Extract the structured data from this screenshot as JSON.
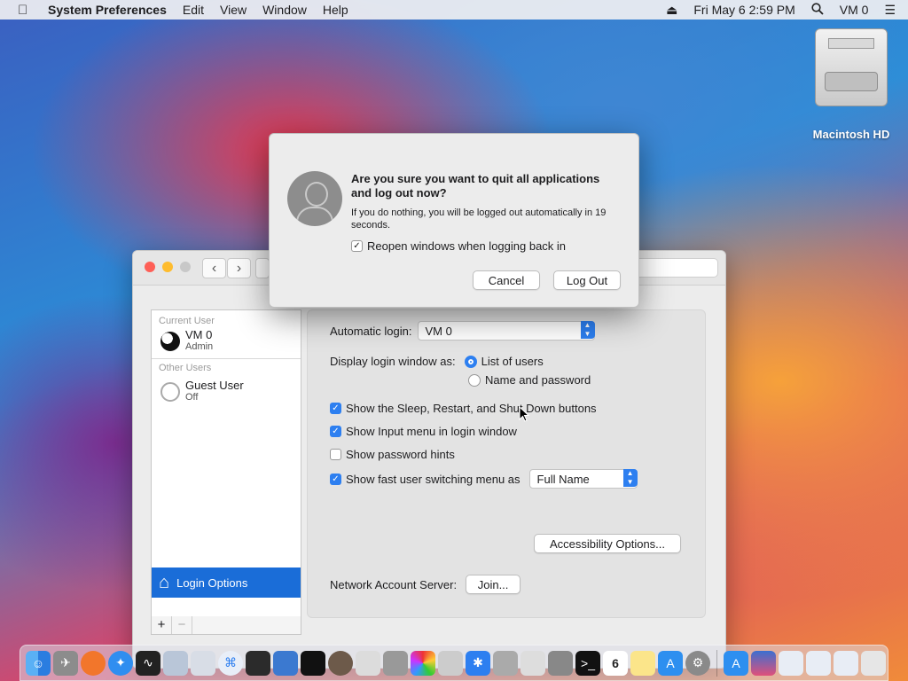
{
  "menubar": {
    "app": "System Preferences",
    "items": [
      "Edit",
      "View",
      "Window",
      "Help"
    ],
    "datetime": "Fri May 6  2:59 PM",
    "user": "VM 0"
  },
  "desktop": {
    "drive_label": "Macintosh HD"
  },
  "dialog": {
    "title": "Are you sure you want to quit all applications and log out now?",
    "info": "If you do nothing, you will be logged out automatically in 19 seconds.",
    "reopen_label": "Reopen windows when logging back in",
    "reopen_checked": true,
    "cancel": "Cancel",
    "logout": "Log Out"
  },
  "sidebar": {
    "current_user_header": "Current User",
    "current_user": {
      "name": "VM 0",
      "role": "Admin"
    },
    "other_users_header": "Other Users",
    "other_user": {
      "name": "Guest User",
      "role": "Off"
    },
    "login_options": "Login Options",
    "add": "+",
    "remove": "−"
  },
  "panel": {
    "automatic_login_label": "Automatic login:",
    "automatic_login_value": "VM 0",
    "display_login_label": "Display login window as:",
    "radio_list": "List of users",
    "radio_name": "Name and password",
    "cb_sleep": "Show the Sleep, Restart, and Shut Down buttons",
    "cb_input": "Show Input menu in login window",
    "cb_hints": "Show password hints",
    "cb_fast": "Show fast user switching menu as",
    "fast_value": "Full Name",
    "accessibility": "Accessibility Options...",
    "network_label": "Network Account Server:",
    "join": "Join..."
  },
  "calendar_day": "6",
  "colors": {
    "accent": "#2d7ff0",
    "selection": "#1a6dd8",
    "close": "#fe5f57",
    "minimize": "#febc2e",
    "zoom": "#c8c8c8"
  }
}
